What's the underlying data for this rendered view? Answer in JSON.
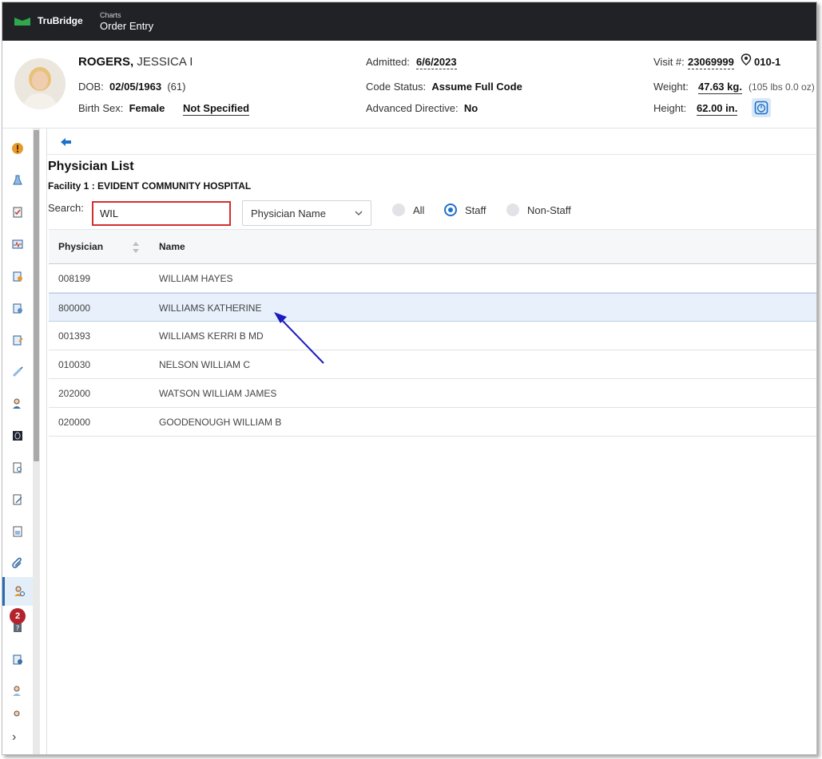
{
  "app": {
    "brand": "TruBridge",
    "module_sub": "Charts",
    "module_title": "Order Entry"
  },
  "patient": {
    "last_name": "ROGERS,",
    "first_name": "JESSICA I",
    "dob_label": "DOB:",
    "dob": "02/05/1963",
    "age": "(61)",
    "sex_label": "Birth Sex:",
    "sex": "Female",
    "sex_link": "Not Specified",
    "admitted_label": "Admitted:",
    "admitted": "6/6/2023",
    "code_label": "Code Status:",
    "code": "Assume Full Code",
    "directive_label": "Advanced Directive:",
    "directive": "No",
    "visit_label": "Visit #:",
    "visit": "23069999",
    "room": "010-1",
    "weight_label": "Weight:",
    "weight": "47.63 kg.",
    "weight_alt": "(105 lbs 0.0 oz)",
    "height_label": "Height:",
    "height": "62.00 in."
  },
  "sidebar": {
    "badge_count": "2",
    "expand_glyph": "›"
  },
  "page": {
    "title": "Physician List",
    "facility": "Facility 1 : EVIDENT COMMUNITY HOSPITAL",
    "search_label": "Search:",
    "search_value": "WIL",
    "select_value": "Physician Name",
    "radios": [
      "All",
      "Staff",
      "Non-Staff"
    ],
    "selected_radio": "Staff"
  },
  "table": {
    "columns": [
      "Physician",
      "Name"
    ],
    "rows": [
      {
        "id": "008199",
        "name": "WILLIAM HAYES"
      },
      {
        "id": "800000",
        "name": "WILLIAMS KATHERINE"
      },
      {
        "id": "001393",
        "name": "WILLIAMS KERRI B MD"
      },
      {
        "id": "010030",
        "name": "NELSON WILLIAM C"
      },
      {
        "id": "202000",
        "name": "WATSON WILLIAM JAMES"
      },
      {
        "id": "020000",
        "name": "GOODENOUGH WILLIAM B"
      }
    ],
    "selected_row_index": 1
  },
  "colors": {
    "accent": "#1e70c9",
    "alert": "#b3232b",
    "header_bg": "#212226",
    "search_border": "#d32f2f",
    "annotation_arrow": "#1b1bbf"
  }
}
